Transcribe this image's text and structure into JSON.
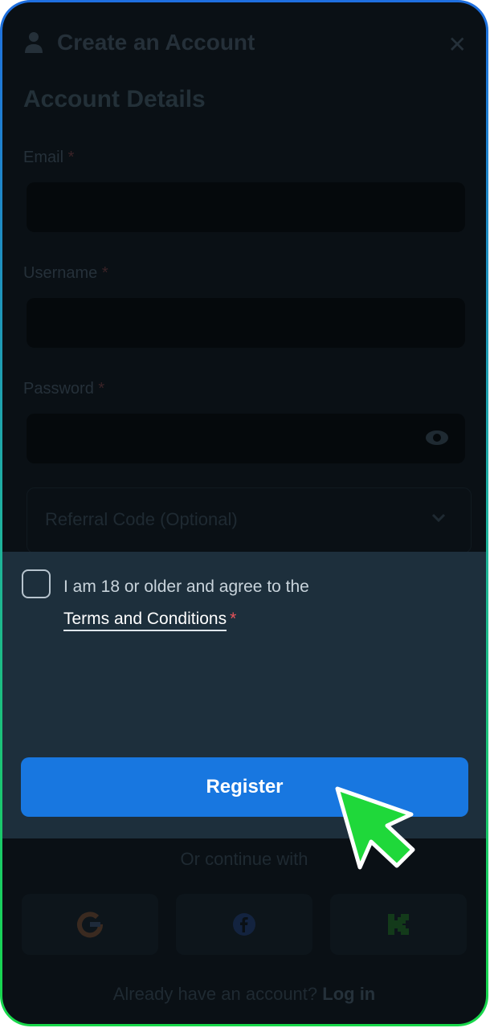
{
  "header": {
    "title": "Create an Account",
    "close_icon": "close-icon",
    "user_icon": "user-icon"
  },
  "form": {
    "section_title": "Account Details",
    "email_label": "Email",
    "username_label": "Username",
    "password_label": "Password",
    "required_mark": "*",
    "referral_placeholder": "Referral Code (Optional)"
  },
  "consent": {
    "line1": "I am 18 or older and agree to the",
    "terms_link": "Terms and Conditions",
    "required_mark": "*",
    "checked": false
  },
  "actions": {
    "register_label": "Register"
  },
  "social": {
    "divider_text": "Or continue with",
    "providers": [
      "google-icon",
      "facebook-icon",
      "kick-icon"
    ]
  },
  "footer": {
    "prompt": "Already have an account?",
    "login_label": "Log in"
  },
  "colors": {
    "primary": "#1877e0",
    "panel": "#1d2f3c",
    "required": "#e8535a",
    "cursor": "#1fd83a"
  }
}
